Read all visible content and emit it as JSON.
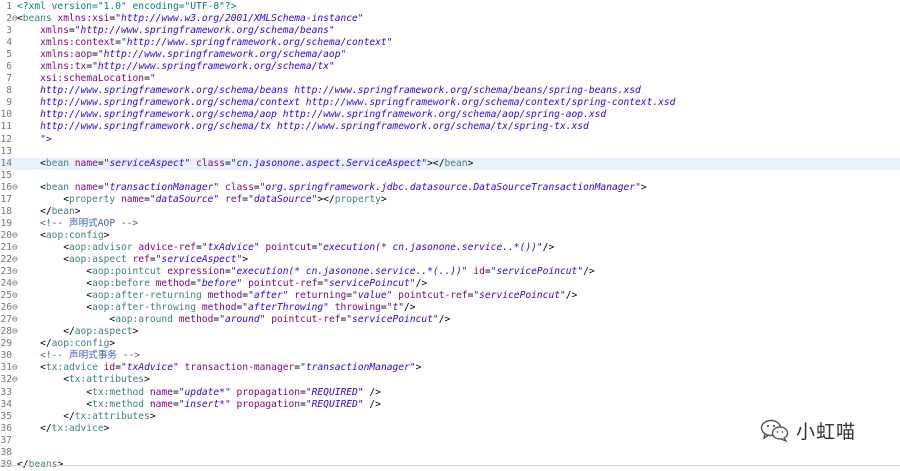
{
  "editor": {
    "highlighted_line": 14,
    "lines": [
      {
        "n": "1",
        "fold": "",
        "tokens": [
          [
            "x",
            "<?xml version=\"1.0\" encoding=\"UTF-8\"?>"
          ]
        ]
      },
      {
        "n": "2",
        "fold": "⊖",
        "tokens": [
          [
            "p",
            "<"
          ],
          [
            "t",
            "beans"
          ],
          [
            "p",
            " "
          ],
          [
            "a",
            "xmlns:xsi"
          ],
          [
            "p",
            "="
          ],
          [
            "v",
            "\"http://www.w3.org/2001/XMLSchema-instance\""
          ]
        ]
      },
      {
        "n": "3",
        "fold": "",
        "tokens": [
          [
            "p",
            "    "
          ],
          [
            "a",
            "xmlns"
          ],
          [
            "p",
            "="
          ],
          [
            "v",
            "\"http://www.springframework.org/schema/beans\""
          ]
        ]
      },
      {
        "n": "4",
        "fold": "",
        "tokens": [
          [
            "p",
            "    "
          ],
          [
            "a",
            "xmlns:context"
          ],
          [
            "p",
            "="
          ],
          [
            "v",
            "\"http://www.springframework.org/schema/context\""
          ]
        ]
      },
      {
        "n": "5",
        "fold": "",
        "tokens": [
          [
            "p",
            "    "
          ],
          [
            "a",
            "xmlns:aop"
          ],
          [
            "p",
            "="
          ],
          [
            "v",
            "\"http://www.springframework.org/schema/aop\""
          ]
        ]
      },
      {
        "n": "6",
        "fold": "",
        "tokens": [
          [
            "p",
            "    "
          ],
          [
            "a",
            "xmlns:tx"
          ],
          [
            "p",
            "="
          ],
          [
            "v",
            "\"http://www.springframework.org/schema/tx\""
          ]
        ]
      },
      {
        "n": "7",
        "fold": "",
        "tokens": [
          [
            "p",
            "    "
          ],
          [
            "a",
            "xsi:schemaLocation"
          ],
          [
            "p",
            "="
          ],
          [
            "v",
            "\""
          ]
        ]
      },
      {
        "n": "8",
        "fold": "",
        "tokens": [
          [
            "v",
            "    http://www.springframework.org/schema/beans http://www.springframework.org/schema/beans/spring-beans.xsd"
          ]
        ]
      },
      {
        "n": "9",
        "fold": "",
        "tokens": [
          [
            "v",
            "    http://www.springframework.org/schema/context http://www.springframework.org/schema/context/spring-context.xsd"
          ]
        ]
      },
      {
        "n": "10",
        "fold": "",
        "tokens": [
          [
            "v",
            "    http://www.springframework.org/schema/aop http://www.springframework.org/schema/aop/spring-aop.xsd"
          ]
        ]
      },
      {
        "n": "11",
        "fold": "",
        "tokens": [
          [
            "v",
            "    http://www.springframework.org/schema/tx http://www.springframework.org/schema/tx/spring-tx.xsd"
          ]
        ]
      },
      {
        "n": "12",
        "fold": "",
        "tokens": [
          [
            "v",
            "    \">"
          ]
        ]
      },
      {
        "n": "13",
        "fold": "",
        "tokens": []
      },
      {
        "n": "14",
        "fold": "",
        "tokens": [
          [
            "p",
            "    <"
          ],
          [
            "t",
            "bean"
          ],
          [
            "p",
            " "
          ],
          [
            "a",
            "name"
          ],
          [
            "p",
            "="
          ],
          [
            "v",
            "\"serviceAspect\""
          ],
          [
            "p",
            " "
          ],
          [
            "a",
            "class"
          ],
          [
            "p",
            "="
          ],
          [
            "v",
            "\"cn.jasonone.aspect.ServiceAspect\""
          ],
          [
            "p",
            "></"
          ],
          [
            "t",
            "bean"
          ],
          [
            "p",
            ">"
          ]
        ]
      },
      {
        "n": "15",
        "fold": "",
        "tokens": []
      },
      {
        "n": "16",
        "fold": "⊖",
        "tokens": [
          [
            "p",
            "    <"
          ],
          [
            "t",
            "bean"
          ],
          [
            "p",
            " "
          ],
          [
            "a",
            "name"
          ],
          [
            "p",
            "="
          ],
          [
            "v",
            "\"transactionManager\""
          ],
          [
            "p",
            " "
          ],
          [
            "a",
            "class"
          ],
          [
            "p",
            "="
          ],
          [
            "v",
            "\"org.springframework.jdbc.datasource.DataSourceTransactionManager\""
          ],
          [
            "p",
            ">"
          ]
        ]
      },
      {
        "n": "17",
        "fold": "",
        "tokens": [
          [
            "p",
            "        <"
          ],
          [
            "t",
            "property"
          ],
          [
            "p",
            " "
          ],
          [
            "a",
            "name"
          ],
          [
            "p",
            "="
          ],
          [
            "v",
            "\"dataSource\""
          ],
          [
            "p",
            " "
          ],
          [
            "a",
            "ref"
          ],
          [
            "p",
            "="
          ],
          [
            "v",
            "\"dataSource\""
          ],
          [
            "p",
            "></"
          ],
          [
            "t",
            "property"
          ],
          [
            "p",
            ">"
          ]
        ]
      },
      {
        "n": "18",
        "fold": "",
        "tokens": [
          [
            "p",
            "    </"
          ],
          [
            "t",
            "bean"
          ],
          [
            "p",
            ">"
          ]
        ]
      },
      {
        "n": "19",
        "fold": "",
        "tokens": [
          [
            "p",
            "    "
          ],
          [
            "c",
            "<!-- 声明式AOP -->"
          ]
        ]
      },
      {
        "n": "20",
        "fold": "⊖",
        "tokens": [
          [
            "p",
            "    <"
          ],
          [
            "t",
            "aop:config"
          ],
          [
            "p",
            ">"
          ]
        ]
      },
      {
        "n": "21",
        "fold": "⊖",
        "tokens": [
          [
            "p",
            "        <"
          ],
          [
            "t",
            "aop:advisor"
          ],
          [
            "p",
            " "
          ],
          [
            "a",
            "advice-ref"
          ],
          [
            "p",
            "="
          ],
          [
            "v",
            "\"txAdvice\""
          ],
          [
            "p",
            " "
          ],
          [
            "a",
            "pointcut"
          ],
          [
            "p",
            "="
          ],
          [
            "v",
            "\"execution(* cn.jasonone.service..*())\""
          ],
          [
            "p",
            "/>"
          ]
        ]
      },
      {
        "n": "22",
        "fold": "⊖",
        "tokens": [
          [
            "p",
            "        <"
          ],
          [
            "t",
            "aop:aspect"
          ],
          [
            "p",
            " "
          ],
          [
            "a",
            "ref"
          ],
          [
            "p",
            "="
          ],
          [
            "v",
            "\"serviceAspect\""
          ],
          [
            "p",
            ">"
          ]
        ]
      },
      {
        "n": "23",
        "fold": "⊖",
        "tokens": [
          [
            "p",
            "            <"
          ],
          [
            "t",
            "aop:pointcut"
          ],
          [
            "p",
            " "
          ],
          [
            "a",
            "expression"
          ],
          [
            "p",
            "="
          ],
          [
            "v",
            "\"execution(* cn.jasonone.service..*(..))\""
          ],
          [
            "p",
            " "
          ],
          [
            "a",
            "id"
          ],
          [
            "p",
            "="
          ],
          [
            "v",
            "\"servicePoincut\""
          ],
          [
            "p",
            "/>"
          ]
        ]
      },
      {
        "n": "24",
        "fold": "⊖",
        "tokens": [
          [
            "p",
            "            <"
          ],
          [
            "t",
            "aop:before"
          ],
          [
            "p",
            " "
          ],
          [
            "a",
            "method"
          ],
          [
            "p",
            "="
          ],
          [
            "v",
            "\"before\""
          ],
          [
            "p",
            " "
          ],
          [
            "a",
            "pointcut-ref"
          ],
          [
            "p",
            "="
          ],
          [
            "v",
            "\"servicePoincut\""
          ],
          [
            "p",
            "/>"
          ]
        ]
      },
      {
        "n": "25",
        "fold": "⊖",
        "tokens": [
          [
            "p",
            "            <"
          ],
          [
            "t",
            "aop:after-returning"
          ],
          [
            "p",
            " "
          ],
          [
            "a",
            "method"
          ],
          [
            "p",
            "="
          ],
          [
            "v",
            "\"after\""
          ],
          [
            "p",
            " "
          ],
          [
            "a",
            "returning"
          ],
          [
            "p",
            "="
          ],
          [
            "v",
            "\"value\""
          ],
          [
            "p",
            " "
          ],
          [
            "a",
            "pointcut-ref"
          ],
          [
            "p",
            "="
          ],
          [
            "v",
            "\"servicePoincut\""
          ],
          [
            "p",
            "/>"
          ]
        ]
      },
      {
        "n": "26",
        "fold": "⊖",
        "tokens": [
          [
            "p",
            "            <"
          ],
          [
            "t",
            "aop:after-throwing"
          ],
          [
            "p",
            " "
          ],
          [
            "a",
            "method"
          ],
          [
            "p",
            "="
          ],
          [
            "v",
            "\"afterThrowing\""
          ],
          [
            "p",
            " "
          ],
          [
            "a",
            "throwing"
          ],
          [
            "p",
            "="
          ],
          [
            "v",
            "\"t\""
          ],
          [
            "p",
            "/>"
          ]
        ]
      },
      {
        "n": "27",
        "fold": "⊖",
        "tokens": [
          [
            "p",
            "                <"
          ],
          [
            "t",
            "aop:around"
          ],
          [
            "p",
            " "
          ],
          [
            "a",
            "method"
          ],
          [
            "p",
            "="
          ],
          [
            "v",
            "\"around\""
          ],
          [
            "p",
            " "
          ],
          [
            "a",
            "pointcut-ref"
          ],
          [
            "p",
            "="
          ],
          [
            "v",
            "\"servicePoincut\""
          ],
          [
            "p",
            "/>"
          ]
        ]
      },
      {
        "n": "28",
        "fold": "⊖",
        "tokens": [
          [
            "p",
            "        </"
          ],
          [
            "t",
            "aop:aspect"
          ],
          [
            "p",
            ">"
          ]
        ]
      },
      {
        "n": "29",
        "fold": "",
        "tokens": [
          [
            "p",
            "    </"
          ],
          [
            "t",
            "aop:config"
          ],
          [
            "p",
            ">"
          ]
        ]
      },
      {
        "n": "30",
        "fold": "",
        "tokens": [
          [
            "p",
            "    "
          ],
          [
            "c",
            "<!-- 声明式事务 -->"
          ]
        ]
      },
      {
        "n": "31",
        "fold": "⊖",
        "tokens": [
          [
            "p",
            "    <"
          ],
          [
            "t",
            "tx:advice"
          ],
          [
            "p",
            " "
          ],
          [
            "a",
            "id"
          ],
          [
            "p",
            "="
          ],
          [
            "v",
            "\"txAdvice\""
          ],
          [
            "p",
            " "
          ],
          [
            "a",
            "transaction-manager"
          ],
          [
            "p",
            "="
          ],
          [
            "v",
            "\"transactionManager\""
          ],
          [
            "p",
            ">"
          ]
        ]
      },
      {
        "n": "32",
        "fold": "⊖",
        "tokens": [
          [
            "p",
            "        <"
          ],
          [
            "t",
            "tx:attributes"
          ],
          [
            "p",
            ">"
          ]
        ]
      },
      {
        "n": "33",
        "fold": "",
        "tokens": [
          [
            "p",
            "            <"
          ],
          [
            "t",
            "tx:method"
          ],
          [
            "p",
            " "
          ],
          [
            "a",
            "name"
          ],
          [
            "p",
            "="
          ],
          [
            "v",
            "\"update*\""
          ],
          [
            "p",
            " "
          ],
          [
            "a",
            "propagation"
          ],
          [
            "p",
            "="
          ],
          [
            "v",
            "\"REQUIRED\""
          ],
          [
            "p",
            " />"
          ]
        ]
      },
      {
        "n": "34",
        "fold": "",
        "tokens": [
          [
            "p",
            "            <"
          ],
          [
            "t",
            "tx:method"
          ],
          [
            "p",
            " "
          ],
          [
            "a",
            "name"
          ],
          [
            "p",
            "="
          ],
          [
            "v",
            "\"insert*\""
          ],
          [
            "p",
            " "
          ],
          [
            "a",
            "propagation"
          ],
          [
            "p",
            "="
          ],
          [
            "v",
            "\"REQUIRED\""
          ],
          [
            "p",
            " />"
          ]
        ]
      },
      {
        "n": "35",
        "fold": "",
        "tokens": [
          [
            "p",
            "        </"
          ],
          [
            "t",
            "tx:attributes"
          ],
          [
            "p",
            ">"
          ]
        ]
      },
      {
        "n": "36",
        "fold": "",
        "tokens": [
          [
            "p",
            "    </"
          ],
          [
            "t",
            "tx:advice"
          ],
          [
            "p",
            ">"
          ]
        ]
      },
      {
        "n": "37",
        "fold": "",
        "tokens": []
      },
      {
        "n": "38",
        "fold": "",
        "tokens": []
      },
      {
        "n": "39",
        "fold": "",
        "tokens": [
          [
            "p",
            "</"
          ],
          [
            "t",
            "beans"
          ],
          [
            "p",
            ">"
          ]
        ]
      }
    ]
  },
  "watermark": {
    "icon": "wechat-icon",
    "text": "小虹喵"
  },
  "colors": {
    "tag": "#3f7f7f",
    "attribute": "#7f007f",
    "value": "#2a00ff",
    "comment": "#3f5fbf",
    "line_number": "#787878",
    "highlight": "#e8f2fe"
  }
}
